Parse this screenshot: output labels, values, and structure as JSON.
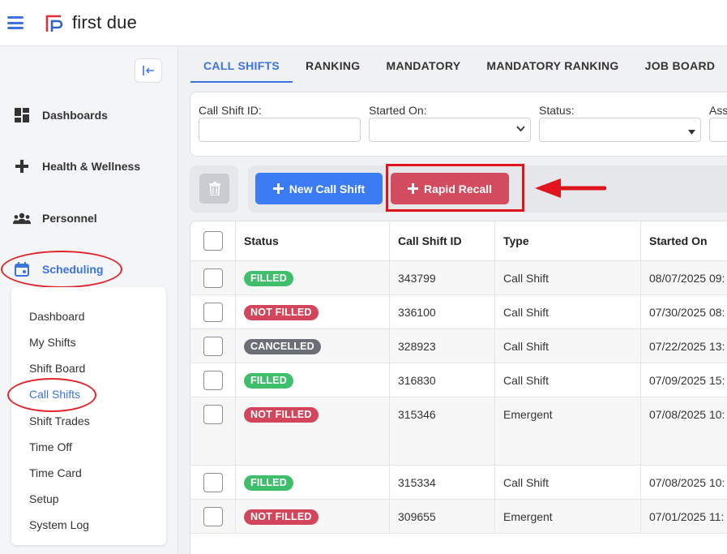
{
  "app": {
    "logo_text": "first due"
  },
  "sidebar": {
    "items": [
      {
        "label": "Dashboards",
        "icon": "grid-icon"
      },
      {
        "label": "Health & Wellness",
        "icon": "plus-icon"
      },
      {
        "label": "Personnel",
        "icon": "people-icon"
      },
      {
        "label": "Scheduling",
        "icon": "calendar-icon"
      }
    ],
    "submenu": [
      "Dashboard",
      "My Shifts",
      "Shift Board",
      "Call Shifts",
      "Shift Trades",
      "Time Off",
      "Time Card",
      "Setup",
      "System Log"
    ]
  },
  "tabs": [
    "CALL SHIFTS",
    "RANKING",
    "MANDATORY",
    "MANDATORY RANKING",
    "JOB BOARD"
  ],
  "filters": {
    "call_shift_id": "Call Shift ID:",
    "started_on": "Started On:",
    "status": "Status:",
    "assigned": "Ass"
  },
  "actions": {
    "new_call_shift": "New Call Shift",
    "rapid_recall": "Rapid Recall"
  },
  "table": {
    "headers": [
      "Status",
      "Call Shift ID",
      "Type",
      "Started On"
    ],
    "rows": [
      {
        "status": "FILLED",
        "id": "343799",
        "type": "Call Shift",
        "started": "08/07/2025 09:"
      },
      {
        "status": "NOT FILLED",
        "id": "336100",
        "type": "Call Shift",
        "started": "07/30/2025 08:"
      },
      {
        "status": "CANCELLED",
        "id": "328923",
        "type": "Call Shift",
        "started": "07/22/2025 13:"
      },
      {
        "status": "FILLED",
        "id": "316830",
        "type": "Call Shift",
        "started": "07/09/2025 15:"
      },
      {
        "status": "NOT FILLED",
        "id": "315346",
        "type": "Emergent",
        "started": "07/08/2025 10:"
      },
      {
        "status": "FILLED",
        "id": "315334",
        "type": "Call Shift",
        "started": "07/08/2025 10:"
      },
      {
        "status": "NOT FILLED",
        "id": "309655",
        "type": "Emergent",
        "started": "07/01/2025 11:"
      }
    ]
  },
  "colors": {
    "accent": "#3b73e0",
    "filled": "#3fbf6b",
    "not_filled": "#d2455a",
    "cancelled": "#6b6f75",
    "annotation": "#e0141c"
  }
}
